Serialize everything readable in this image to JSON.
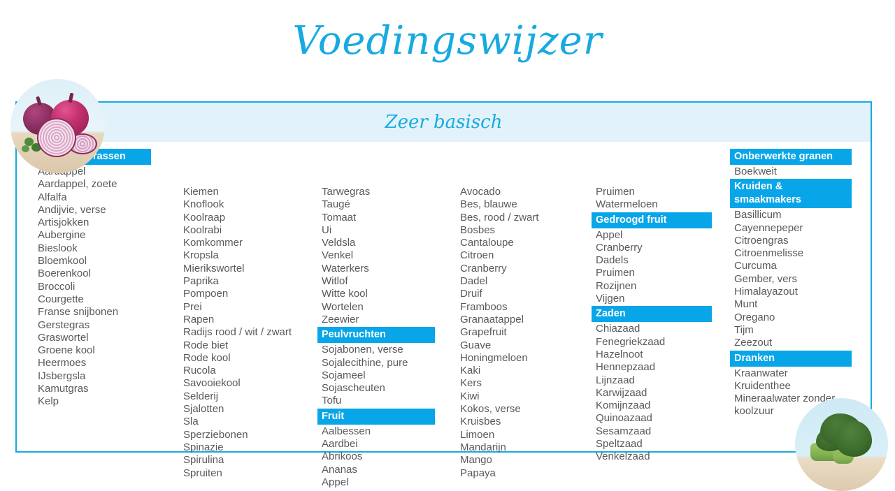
{
  "title": "Voedingswijzer",
  "band_title": "Zeer basisch",
  "photos": {
    "top_left": "red-onions-photo",
    "bottom_right": "broccoli-photo"
  },
  "columns": [
    {
      "id": "column-1",
      "blocks": [
        {
          "header": "Groente / Grassen",
          "items": [
            "Aardappel",
            "Aardappel, zoete",
            "Alfalfa",
            "Andijvie, verse",
            "Artisjokken",
            "Aubergine",
            "Bieslook",
            "Bloemkool",
            "Boerenkool",
            "Broccoli",
            "Courgette",
            "Franse snijbonen",
            "Gerstegras",
            "Graswortel",
            "Groene kool",
            "Heermoes",
            "IJsbergsla",
            "Kamutgras",
            "Kelp"
          ]
        }
      ]
    },
    {
      "id": "column-2",
      "blocks": [
        {
          "header": null,
          "items": [
            "Kiemen",
            "Knoflook",
            "Koolraap",
            "Koolrabi",
            "Komkommer",
            "Kropsla",
            "Mierikswortel",
            "Paprika",
            "Pompoen",
            "Prei",
            "Rapen",
            "Radijs rood / wit / zwart",
            "Rode biet",
            "Rode kool",
            "Rucola",
            "Savooiekool",
            "Selderij",
            "Sjalotten",
            "Sla",
            "Sperziebonen",
            "Spinazie",
            "Spirulina",
            "Spruiten"
          ]
        }
      ]
    },
    {
      "id": "column-3",
      "blocks": [
        {
          "header": null,
          "items": [
            "Tarwegras",
            "Taugé",
            "Tomaat",
            "Ui",
            "Veldsla",
            "Venkel",
            "Waterkers",
            "Witlof",
            "Witte kool",
            "Wortelen",
            "Zeewier"
          ]
        },
        {
          "header": "Peulvruchten",
          "items": [
            "Sojabonen, verse",
            "Sojalecithine, pure",
            "Sojameel",
            "Sojascheuten",
            "Tofu"
          ]
        },
        {
          "header": "Fruit",
          "items": [
            "Aalbessen",
            "Aardbei",
            "Abrikoos",
            "Ananas",
            "Appel"
          ]
        }
      ]
    },
    {
      "id": "column-4",
      "blocks": [
        {
          "header": null,
          "items": [
            "Avocado",
            "Bes, blauwe",
            "Bes, rood / zwart",
            "Bosbes",
            "Cantaloupe",
            "Citroen",
            "Cranberry",
            "Dadel",
            "Druif",
            "Framboos",
            "Granaatappel",
            "Grapefruit",
            "Guave",
            "Honingmeloen",
            "Kaki",
            "Kers",
            "Kiwi",
            "Kokos, verse",
            "Kruisbes",
            "Limoen",
            "Mandarijn",
            "Mango",
            "Papaya"
          ]
        }
      ]
    },
    {
      "id": "column-5",
      "blocks": [
        {
          "header": null,
          "items": [
            "Pruimen",
            "Watermeloen"
          ]
        },
        {
          "header": "Gedroogd fruit",
          "items": [
            "Appel",
            "Cranberry",
            "Dadels",
            "Pruimen",
            "Rozijnen",
            "Vijgen"
          ]
        },
        {
          "header": "Zaden",
          "items": [
            "Chiazaad",
            "Fenegriekzaad",
            "Hazelnoot",
            "Hennepzaad",
            "Lijnzaad",
            "Karwijzaad",
            "Komijnzaad",
            "Quinoazaad",
            "Sesamzaad",
            "Speltzaad",
            "Venkelzaad"
          ]
        }
      ]
    },
    {
      "id": "column-6",
      "blocks": [
        {
          "header": "Onberwerkte granen",
          "items": [
            "Boekweit"
          ]
        },
        {
          "header": "Kruiden &\nsmaakmakers",
          "items": [
            "Basillicum",
            "Cayennepeper",
            "Citroengras",
            "Citroenmelisse",
            "Curcuma",
            "Gember, vers",
            "Himalayazout",
            "Munt",
            "Oregano",
            "Tijm",
            "Zeezout"
          ]
        },
        {
          "header": "Dranken",
          "items": [
            "Kraanwater",
            "Kruidenthee",
            "Mineraalwater zonder koolzuur"
          ]
        }
      ]
    }
  ],
  "colors": {
    "accent": "#17aae0",
    "header_bg": "#08a6e8",
    "band_bg": "#e2f2fb",
    "text": "#58595b"
  }
}
